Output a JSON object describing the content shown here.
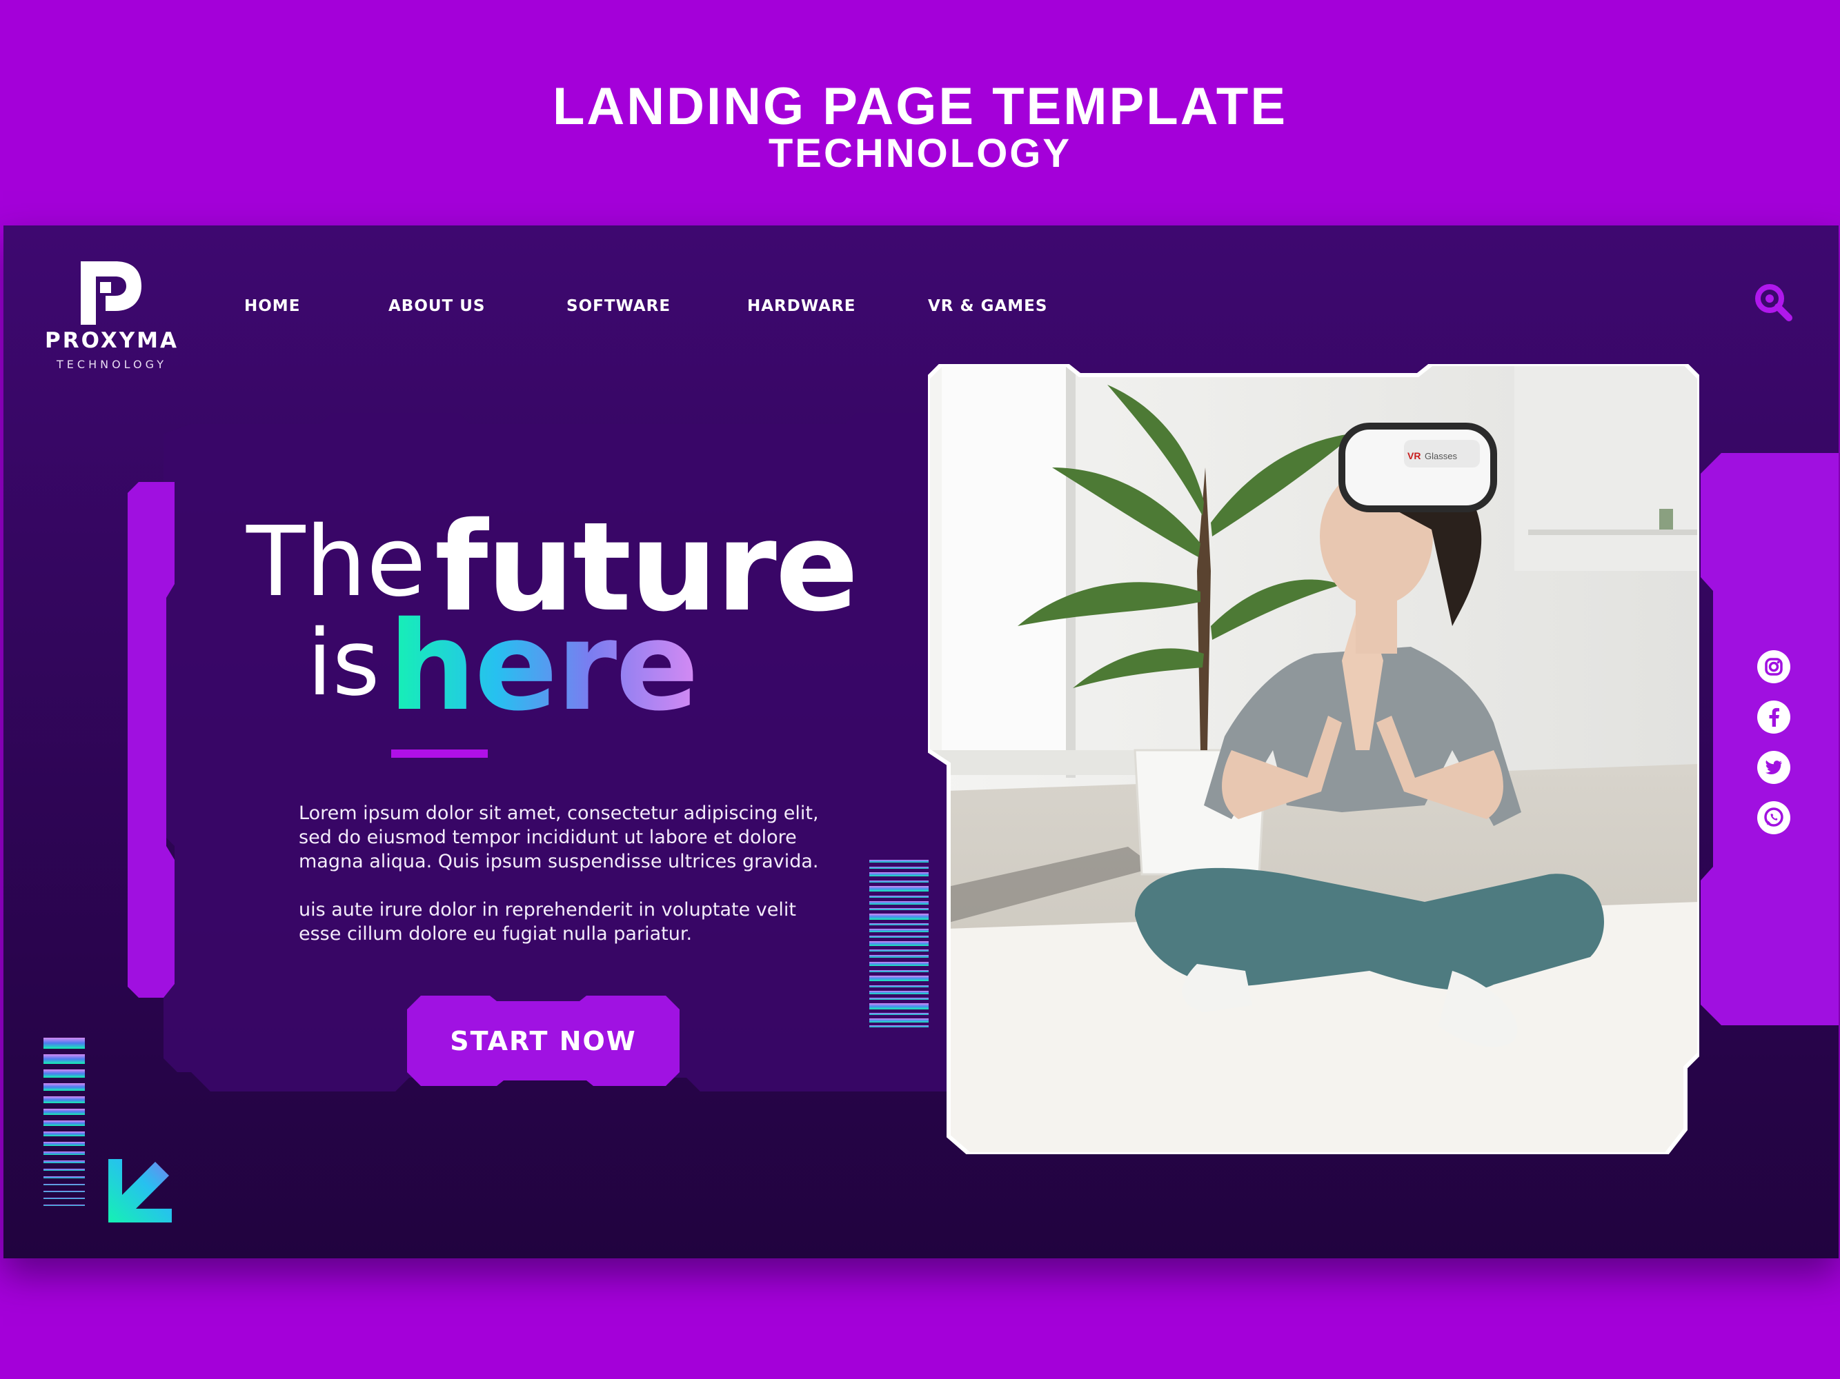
{
  "header": {
    "title": "LANDING PAGE TEMPLATE",
    "subtitle": "TECHNOLOGY"
  },
  "brand": {
    "name": "PROXYMA",
    "tagline": "TECHNOLOGY",
    "logo_icon": "p-letter-logo-icon"
  },
  "nav": {
    "items": [
      {
        "label": "HOME"
      },
      {
        "label": "ABOUT US"
      },
      {
        "label": "SOFTWARE"
      },
      {
        "label": "HARDWARE"
      },
      {
        "label": "VR & GAMES"
      }
    ],
    "search_icon": "search-icon"
  },
  "hero": {
    "line1_a": "The",
    "line1_b": "future",
    "line2_a": "is",
    "line2_b": "here",
    "paragraph1": "Lorem ipsum dolor sit amet, consectetur adipiscing elit, sed do eiusmod tempor incididunt ut labore et dolore magna aliqua. Quis ipsum suspendisse ultrices gravida.",
    "paragraph2": "uis aute irure dolor in reprehenderit in voluptate velit esse cillum dolore eu fugiat nulla pariatur.",
    "cta_label": "START NOW"
  },
  "photo": {
    "headset_brand": "VR Glasses"
  },
  "social": [
    {
      "icon": "instagram-icon"
    },
    {
      "icon": "facebook-icon"
    },
    {
      "icon": "twitter-icon"
    },
    {
      "icon": "whatsapp-icon"
    }
  ],
  "colors": {
    "background": "#a400d9",
    "page_dark": "#2e0555",
    "accent_purple": "#a010e0",
    "gradient_teal": "#15f2b2",
    "gradient_blue": "#27c0f0",
    "gradient_pink": "#d58af3"
  }
}
